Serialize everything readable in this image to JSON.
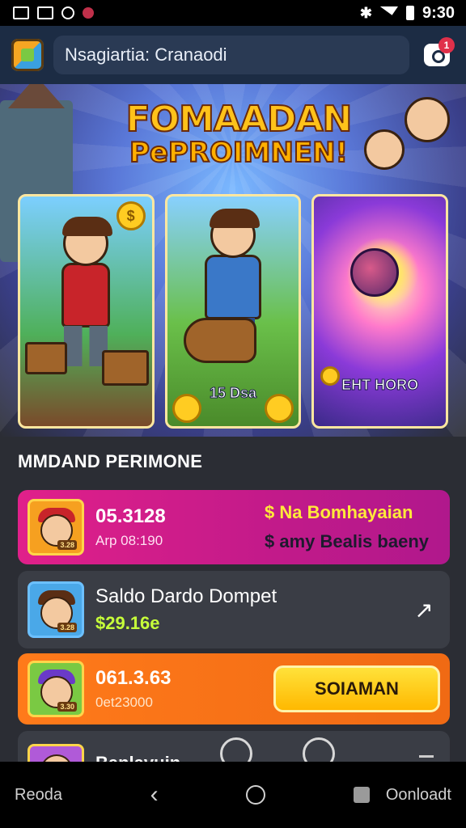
{
  "status_bar": {
    "time": "9:30",
    "bluetooth": "bluetooth-icon",
    "wifi": "wifi-icon",
    "battery": "battery-icon"
  },
  "top_bar": {
    "search_text": "Nsagiartia: Cranaodi",
    "app_icon": "game-cube-icon",
    "chat_icon": "chat-icon",
    "chat_badge": "1"
  },
  "hero": {
    "title_line1": "FOMAADAN",
    "title_line2": "PePROIMNEN!",
    "cards": [
      {
        "label": ""
      },
      {
        "label": "15 Dsa"
      },
      {
        "label": "EHT HORO"
      }
    ]
  },
  "section_title": "MMDAND PERIMONE",
  "rows": [
    {
      "amount": "05.3128",
      "subline": "Arp 08:190",
      "right_line1": "$ Na Bomhayaian",
      "right_line2": "$ amy Bealis baeny",
      "tag": "3.28"
    },
    {
      "title": "Saldo Dardo Dompet",
      "price": "$29.16e",
      "tag": "3.28"
    },
    {
      "amount": "061.3.63",
      "subline": "0et23000",
      "button": "SOIAMAN",
      "tag": "3.30"
    },
    {
      "title": "Banlavuin"
    }
  ],
  "colors": {
    "accent_pink": "#e0208a",
    "accent_orange": "#ff7a1a",
    "cta_yellow": "#ffcc22",
    "header": "#1c2c44"
  },
  "nav_bar": {
    "left_text": "Reoda",
    "right_text": "Oonloadt"
  }
}
